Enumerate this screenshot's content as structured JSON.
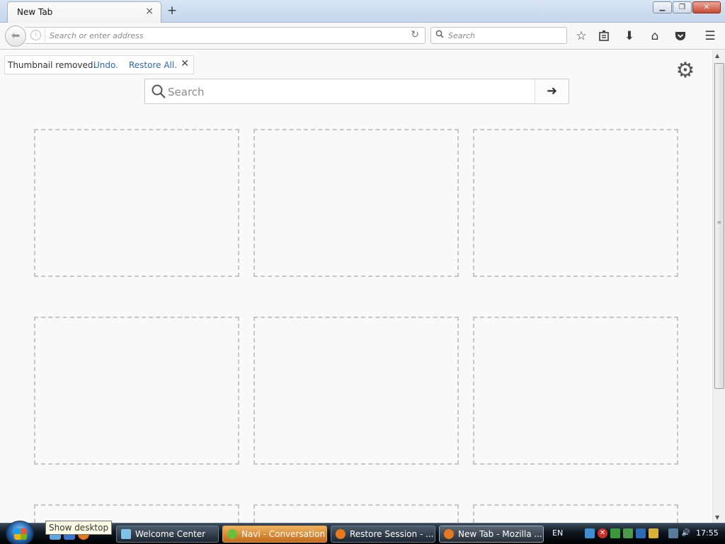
{
  "browser": {
    "tab_title": "New Tab",
    "tab_close": "×",
    "new_tab": "+",
    "window_controls": {
      "minimize": "▁",
      "restore": "❐",
      "close": "✕"
    },
    "url_placeholder": "Search or enter address",
    "search_placeholder": "Search",
    "toolbar_icons": [
      "star-icon",
      "reading-list-icon",
      "download-icon",
      "home-icon",
      "pocket-icon",
      "menu-icon"
    ]
  },
  "newtab": {
    "undo_message": "Thumbnail removed.",
    "undo_label": "Undo.",
    "restore_label": "Restore All.",
    "close": "✕",
    "search_placeholder": "Search",
    "go_arrow": "➜",
    "tile_count": 9
  },
  "taskbar": {
    "tooltip": "Show desktop",
    "tasks": [
      {
        "label": "Welcome Center",
        "state": "normal",
        "icon_color": "#7fc2e6"
      },
      {
        "label": "Navi - Conversation",
        "state": "highlighted",
        "icon_color": "#6bbf3a"
      },
      {
        "label": "Restore Session - ...",
        "state": "normal",
        "icon_color": "#e8781e"
      },
      {
        "label": "New Tab - Mozilla ...",
        "state": "active",
        "icon_color": "#e8781e"
      }
    ],
    "language": "EN",
    "clock": "17:55"
  }
}
